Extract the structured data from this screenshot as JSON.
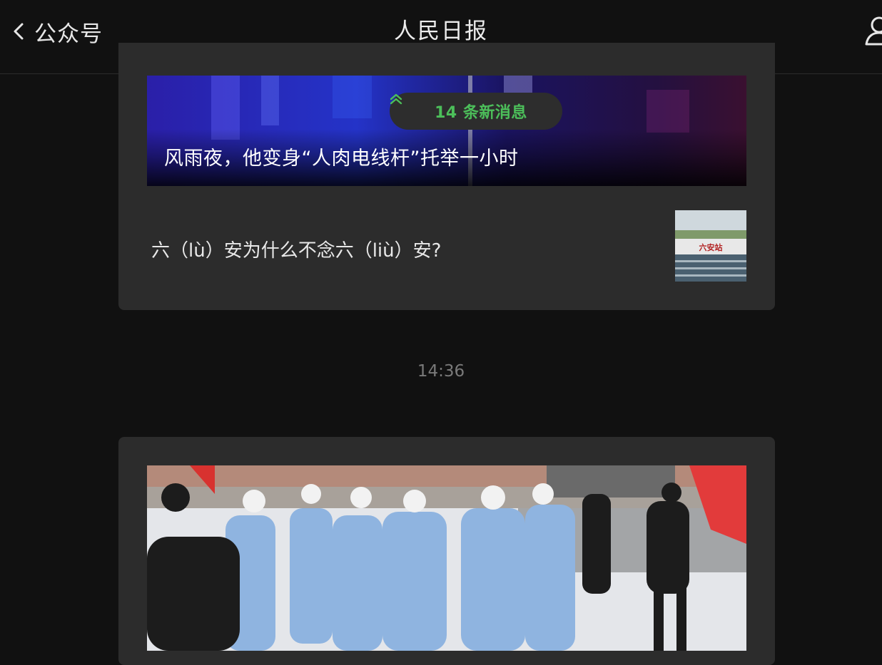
{
  "header": {
    "back_label": "公众号",
    "title": "人民日报"
  },
  "feed": {
    "lead_article_title": "风雨夜，他变身“人肉电线杆”托举一小时",
    "new_messages": "14 条新消息",
    "article_2_title": "六（lù）安为什么不念六（liù）安?",
    "thumb_sign_text": "六安站",
    "timestamp": "14:36"
  },
  "colors": {
    "background": "#111111",
    "card": "#2c2c2c",
    "accent_green": "#4cbf5a",
    "timestamp": "#7a7a7a"
  },
  "icons": {
    "back": "chevron-left-icon",
    "profile": "person-icon",
    "new_messages": "double-chevron-up-icon"
  }
}
